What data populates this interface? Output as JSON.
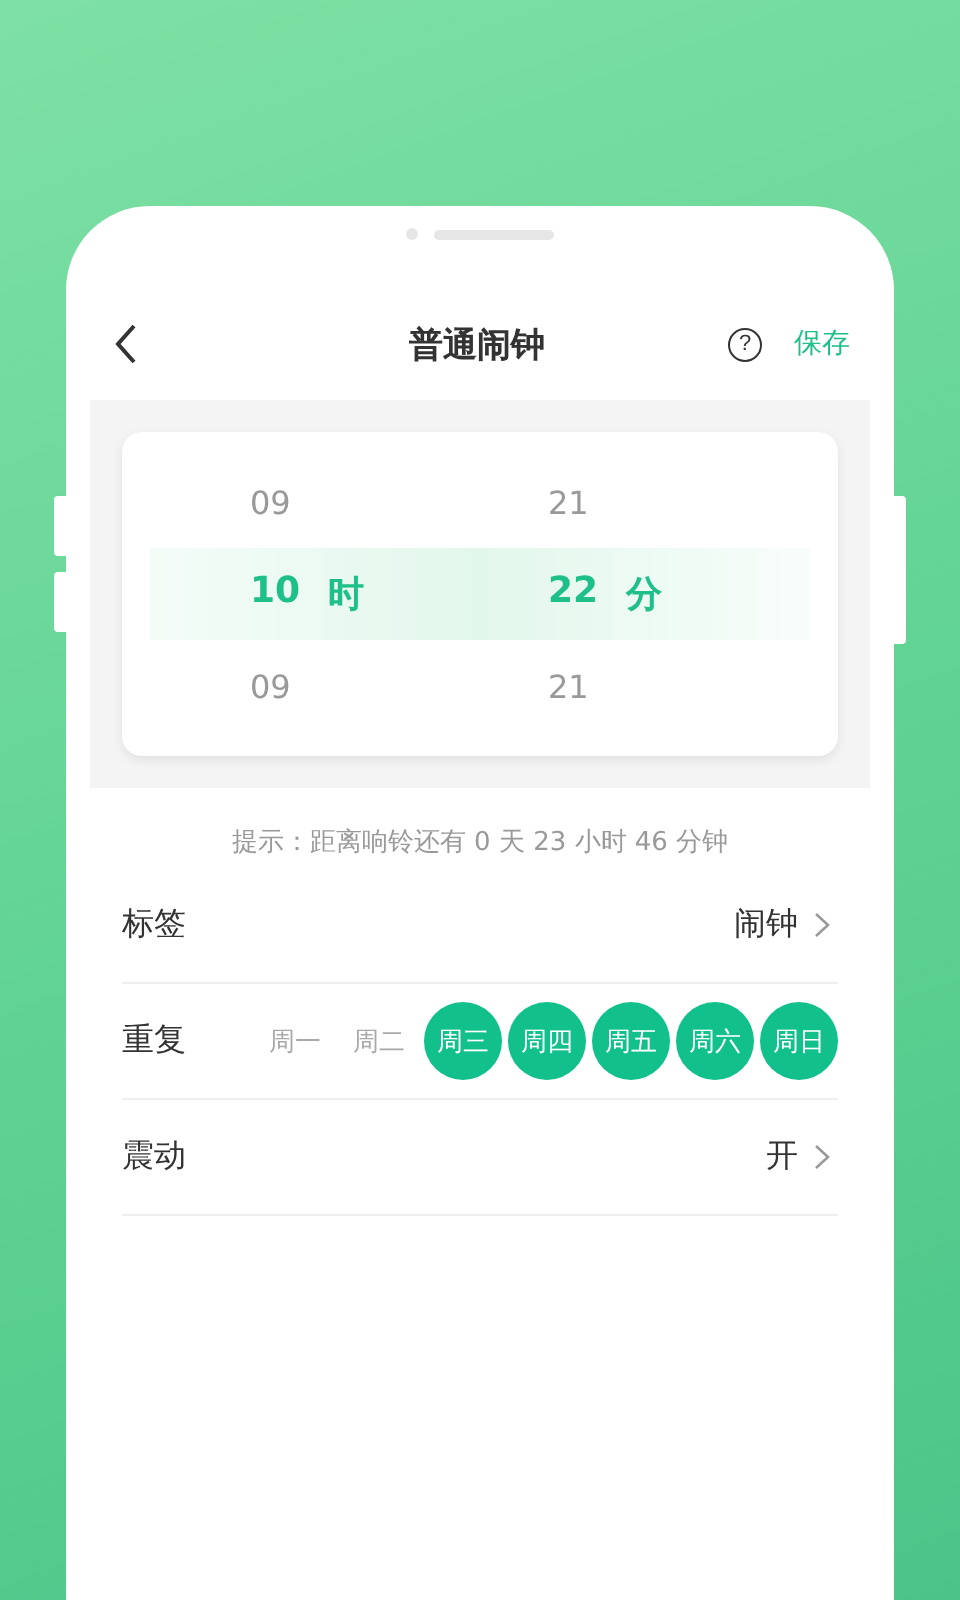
{
  "header": {
    "title": "普通闹钟",
    "help": "?",
    "save": "保存"
  },
  "picker": {
    "columns": [
      {
        "above": "09",
        "value": "10",
        "unit": "时",
        "below": "09"
      },
      {
        "above": "21",
        "value": "22",
        "unit": "分",
        "below": "21"
      }
    ]
  },
  "hint": "提示：距离响铃还有 0 天 23 小时 46 分钟",
  "settings": [
    {
      "kind": "value",
      "label": "标签",
      "value": "闹钟"
    },
    {
      "kind": "days",
      "label": "重复",
      "days": [
        {
          "label": "周一",
          "selected": false
        },
        {
          "label": "周二",
          "selected": false
        },
        {
          "label": "周三",
          "selected": true
        },
        {
          "label": "周四",
          "selected": true
        },
        {
          "label": "周五",
          "selected": true
        },
        {
          "label": "周六",
          "selected": true
        },
        {
          "label": "周日",
          "selected": true
        }
      ]
    },
    {
      "kind": "value",
      "label": "震动",
      "value": "开"
    }
  ]
}
